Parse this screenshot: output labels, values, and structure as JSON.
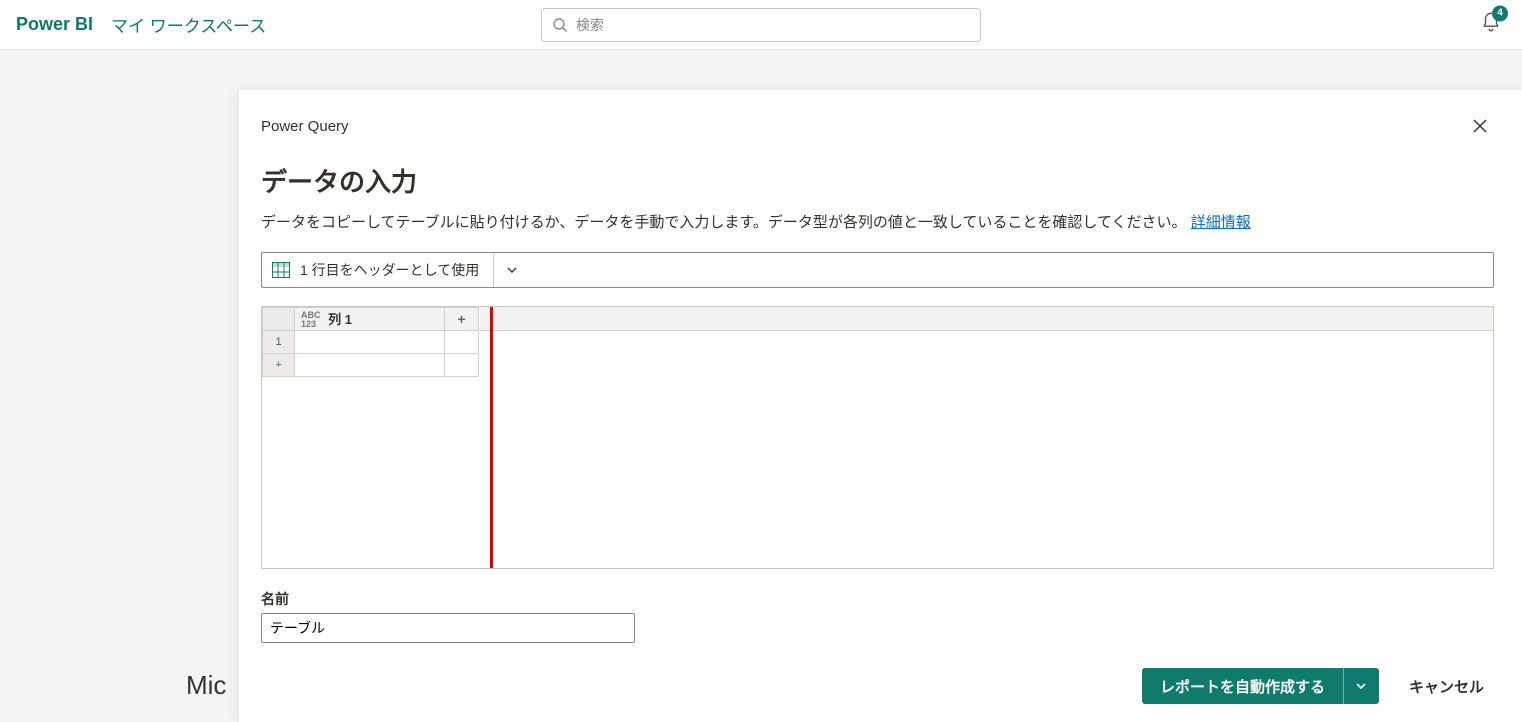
{
  "header": {
    "app_name": "Power BI",
    "workspace": "マイ ワークスペース",
    "search_placeholder": "検索",
    "notification_count": "4"
  },
  "background": {
    "partial_text": "Mic"
  },
  "modal": {
    "breadcrumb_title": "Power Query",
    "title": "データの入力",
    "description": "データをコピーしてテーブルに貼り付けるか、データを手動で入力します。データ型が各列の値と一致していることを確認してください。",
    "learn_more": "詳細情報",
    "header_row_button": "1 行目をヘッダーとして使用",
    "grid": {
      "col1_type_top": "ABC",
      "col1_type_bottom": "123",
      "col1_name": "列 1",
      "add_col": "+",
      "row1_num": "1",
      "add_row": "+"
    },
    "name_label": "名前",
    "name_value": "テーブル",
    "primary_button": "レポートを自動作成する",
    "cancel_button": "キャンセル"
  }
}
